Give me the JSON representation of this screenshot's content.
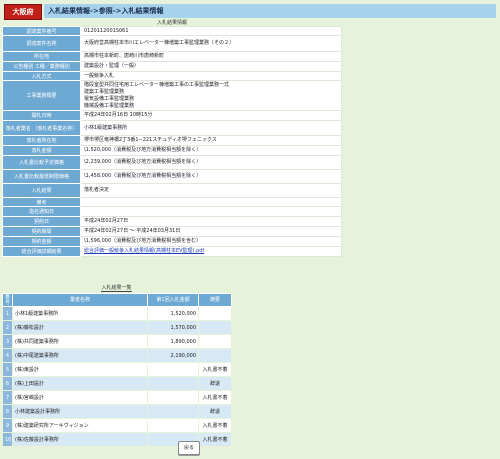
{
  "header": {
    "prefecture": "大阪府",
    "breadcrumb": "入札結果情報->参照->入札結果情報"
  },
  "info_title": "入札結果情報",
  "info_rows": [
    {
      "label": "調達案件番号",
      "value": "0120112001S061"
    },
    {
      "label": "調達案件名称",
      "value": "大阪府営高槻柱本市川エレベーター棟増築工事監理業務（その２）"
    },
    {
      "label": "所在地",
      "value": "高槻市柱本新町、唐崎川市唐崎新町"
    },
    {
      "label": "公告種別 工種／業務種別",
      "value": "建築設計・監理（一般）"
    },
    {
      "label": "入札方式",
      "value": "一般競争入札"
    },
    {
      "label": "工事業務概要",
      "lines": [
        "階段室型共同住宅用エレベーター棟増築工事の工事監理業務一式",
        "建築工事監理業務",
        "電気設備工事監理業務",
        "機械設備工事監理業務"
      ]
    },
    {
      "label": "開札日時",
      "value": "平成24年02月16日 10時15分"
    },
    {
      "label": "落札者業名 （落札者事業名称）",
      "value": "小林1級建築事務所"
    },
    {
      "label": "落札者所在地",
      "value": "堺市堺区竜神橋2丁3番1−221スチュディオ堺フェニックス"
    },
    {
      "label": "落札金額",
      "value": "\\1,520,000（消費税及び地方消費税相当額を除く）"
    },
    {
      "label": "入札書比較予定価格",
      "value": "\\2,239,000（消費税及び地方消費税相当額を除く）"
    },
    {
      "label": "入札書比較最低制限価格",
      "value": "\\1,458,000（消費税及び地方消費税相当額を除く）"
    },
    {
      "label": "入札結果",
      "value": "落札者決定"
    },
    {
      "label": "備考",
      "value": ""
    },
    {
      "label": "指名通知日",
      "value": ""
    },
    {
      "label": "契約日",
      "value": "平成24年02月27日"
    },
    {
      "label": "契約期間",
      "value": "平成24年02月27日 ～ 平成24年03月31日"
    },
    {
      "label": "契約金額",
      "value": "\\1,596,000（消費税及び地方消費税相当額を含む）"
    },
    {
      "label": "総合評価詳細結果",
      "link": "総合評価一般競争入札結果情報(高槻柱本EV監理).pdf"
    }
  ],
  "results_title": "入札結果一覧",
  "results_headers": {
    "no": "番号",
    "name": "業者名称",
    "amount": "第1回入札金額",
    "remarks": "摘要"
  },
  "results": [
    {
      "no": "1",
      "name": "小林1級建築事務所",
      "amount": "1,520,000",
      "remarks": ""
    },
    {
      "no": "2",
      "name": "(株)藤松設計",
      "amount": "1,570,000",
      "remarks": ""
    },
    {
      "no": "3",
      "name": "(株)共同建築事務所",
      "amount": "1,890,000",
      "remarks": ""
    },
    {
      "no": "4",
      "name": "(株)中尾建築事務所",
      "amount": "2,190,000",
      "remarks": ""
    },
    {
      "no": "5",
      "name": "(株)東設計",
      "amount": "",
      "remarks": "入札書不着"
    },
    {
      "no": "6",
      "name": "(株)上田設計",
      "amount": "",
      "remarks": "辞退"
    },
    {
      "no": "7",
      "name": "(株)宮嶋設計",
      "amount": "",
      "remarks": "入札書不着"
    },
    {
      "no": "8",
      "name": "小林建築設計事務所",
      "amount": "",
      "remarks": "辞退"
    },
    {
      "no": "9",
      "name": "(株)建築研究所アーキヴィジョン",
      "amount": "",
      "remarks": "入札書不着"
    },
    {
      "no": "10",
      "name": "(株)佐藤設計事務所",
      "amount": "",
      "remarks": "入札書不着"
    }
  ],
  "back_button": "戻る"
}
